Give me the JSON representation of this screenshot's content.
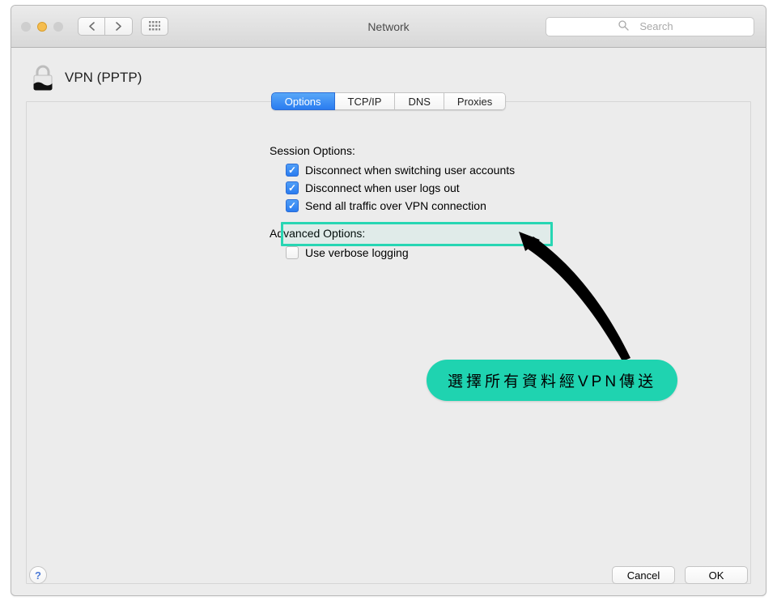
{
  "toolbar": {
    "title": "Network",
    "search_placeholder": "Search"
  },
  "pane": {
    "title": "VPN (PPTP)",
    "tabs": [
      "Options",
      "TCP/IP",
      "DNS",
      "Proxies"
    ],
    "active_tab": 0,
    "session_label": "Session Options:",
    "advanced_label": "Advanced Options:",
    "options": {
      "disconnect_switch": {
        "label": "Disconnect when switching user accounts",
        "checked": true
      },
      "disconnect_logout": {
        "label": "Disconnect when user logs out",
        "checked": true
      },
      "send_all_vpn": {
        "label": "Send all traffic over VPN connection",
        "checked": true
      },
      "verbose_logging": {
        "label": "Use verbose logging",
        "checked": false
      }
    }
  },
  "annotation": {
    "text": "選擇所有資料經VPN傳送"
  },
  "footer": {
    "cancel": "Cancel",
    "ok": "OK",
    "help": "?"
  }
}
